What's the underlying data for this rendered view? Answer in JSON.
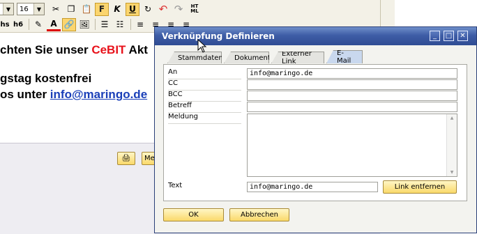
{
  "editor": {
    "font_size": "16",
    "toolbar_bold": "F",
    "toolbar_italic": "K",
    "toolbar_underline": "U",
    "toolbar_html": "HT ML",
    "heading1": "hs",
    "heading2": "h6",
    "line1_prefix": "chten Sie unser ",
    "line1_highlight": "CeBIT",
    "line1_suffix": " Akt",
    "line2": "gstag kostenfrei",
    "line3_prefix": "os unter ",
    "line3_link": "info@maringo.de",
    "bottom_button_label": "Me",
    "colors": {
      "highlight": "#e8121b",
      "link": "#1a3fb8"
    }
  },
  "dialog": {
    "title": "Verknüpfung Definieren",
    "tabs": [
      {
        "label": "Stammdaten",
        "selected": false
      },
      {
        "label": "Dokument",
        "selected": false
      },
      {
        "label": "Externer Link",
        "selected": false
      },
      {
        "label": "E-Mail",
        "selected": true
      }
    ],
    "fields": {
      "an_label": "An",
      "an_value": "info@maringo.de",
      "cc_label": "CC",
      "cc_value": "",
      "bcc_label": "BCC",
      "bcc_value": "",
      "betreff_label": "Betreff",
      "betreff_value": "",
      "meldung_label": "Meldung",
      "meldung_value": ""
    },
    "text_label": "Text",
    "text_value": "info@maringo.de",
    "remove_link_button": "Link entfernen",
    "ok_button": "OK",
    "cancel_button": "Abbrechen"
  }
}
